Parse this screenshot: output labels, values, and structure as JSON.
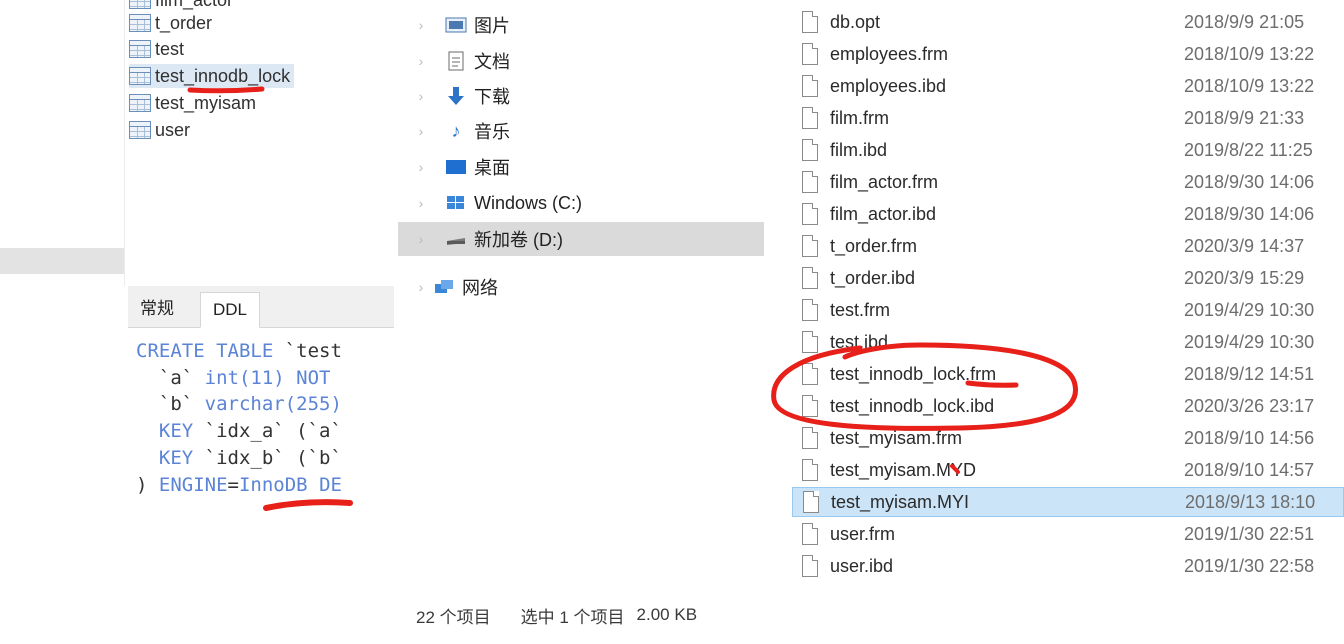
{
  "table_list": {
    "items": [
      {
        "label": "film_actor",
        "selected": false
      },
      {
        "label": "t_order",
        "selected": false
      },
      {
        "label": "test",
        "selected": false
      },
      {
        "label": "test_innodb_lock",
        "selected": true
      },
      {
        "label": "test_myisam",
        "selected": false
      },
      {
        "label": "user",
        "selected": false
      }
    ]
  },
  "tabs": [
    {
      "label": "常规",
      "active": false
    },
    {
      "label": "DDL",
      "active": true
    }
  ],
  "ddl": {
    "line1_kw": "CREATE TABLE",
    "line1_rest": " `test",
    "line2_a": "  `a` ",
    "line2_type": "int(11)",
    "line2_kw": " NOT",
    "line3_a": "  `b` ",
    "line3_type": "varchar(255)",
    "line4_kw": "  KEY",
    "line4_rest": " `idx_a` (`a`",
    "line5_kw": "  KEY",
    "line5_rest": " `idx_b` (`b`",
    "line6_a": ") ",
    "line6_kw": "ENGINE",
    "line6_eq": "=",
    "line6_val": "InnoDB",
    "line6_tail": " DE"
  },
  "nav": {
    "items": [
      {
        "label": "图片",
        "icon": "pictures-icon"
      },
      {
        "label": "文档",
        "icon": "documents-icon"
      },
      {
        "label": "下载",
        "icon": "downloads-icon"
      },
      {
        "label": "音乐",
        "icon": "music-icon"
      },
      {
        "label": "桌面",
        "icon": "desktop-icon"
      },
      {
        "label": "Windows (C:)",
        "icon": "windows-drive-icon"
      },
      {
        "label": "新加卷 (D:)",
        "icon": "drive-icon",
        "selected": true
      },
      {
        "label": "网络",
        "icon": "network-icon"
      }
    ]
  },
  "files": [
    {
      "name": "db.opt",
      "date": "2018/9/9 21:05"
    },
    {
      "name": "employees.frm",
      "date": "2018/10/9 13:22"
    },
    {
      "name": "employees.ibd",
      "date": "2018/10/9 13:22"
    },
    {
      "name": "film.frm",
      "date": "2018/9/9 21:33"
    },
    {
      "name": "film.ibd",
      "date": "2019/8/22 11:25"
    },
    {
      "name": "film_actor.frm",
      "date": "2018/9/30 14:06"
    },
    {
      "name": "film_actor.ibd",
      "date": "2018/9/30 14:06"
    },
    {
      "name": "t_order.frm",
      "date": "2020/3/9 14:37"
    },
    {
      "name": "t_order.ibd",
      "date": "2020/3/9 15:29"
    },
    {
      "name": "test.frm",
      "date": "2019/4/29 10:30"
    },
    {
      "name": "test.ibd",
      "date": "2019/4/29 10:30"
    },
    {
      "name": "test_innodb_lock.frm",
      "date": "2018/9/12 14:51"
    },
    {
      "name": "test_innodb_lock.ibd",
      "date": "2020/3/26 23:17"
    },
    {
      "name": "test_myisam.frm",
      "date": "2018/9/10 14:56"
    },
    {
      "name": "test_myisam.MYD",
      "date": "2018/9/10 14:57"
    },
    {
      "name": "test_myisam.MYI",
      "date": "2018/9/13 18:10",
      "selected": true
    },
    {
      "name": "user.frm",
      "date": "2019/1/30 22:51"
    },
    {
      "name": "user.ibd",
      "date": "2019/1/30 22:58"
    }
  ],
  "status": {
    "count": "22 个项目",
    "selection": "选中 1 个项目",
    "size": "2.00 KB"
  },
  "colors": {
    "annotation": "#e8201a",
    "selection_blue": "#cce4f7",
    "keyword_blue": "#5b84d6"
  }
}
